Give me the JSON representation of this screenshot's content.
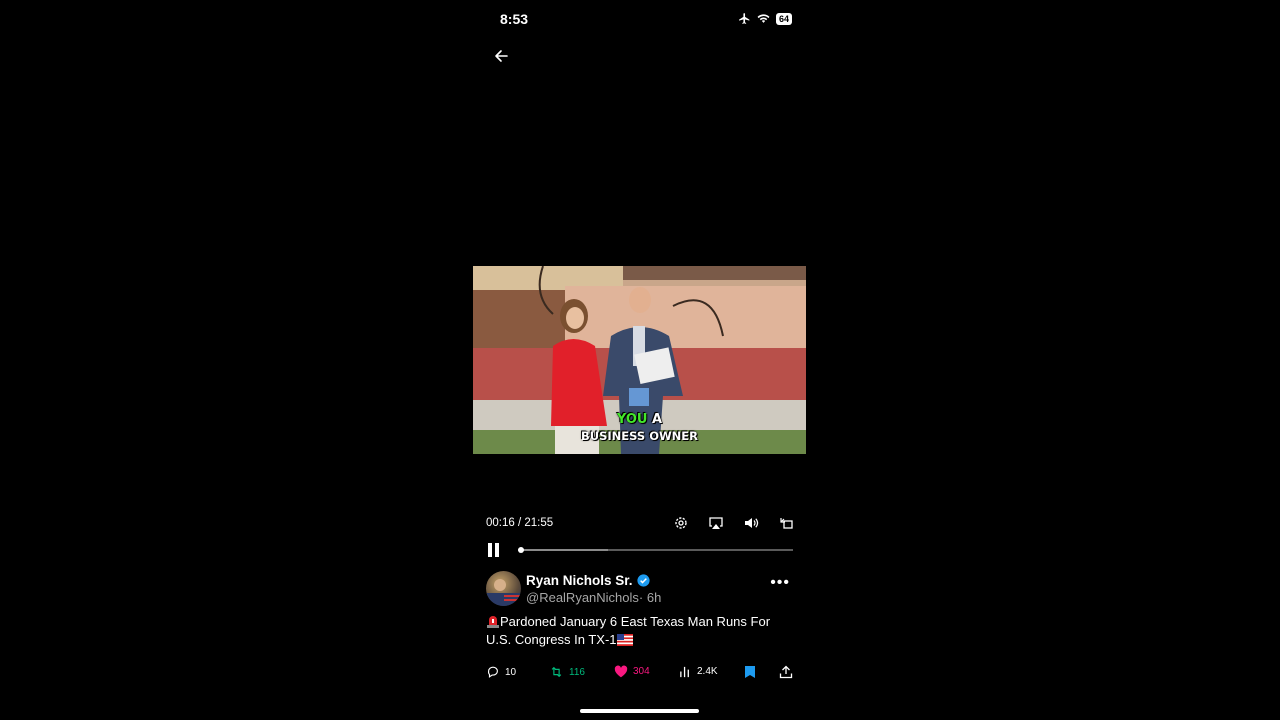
{
  "status_bar": {
    "time": "8:53",
    "battery": "64"
  },
  "video": {
    "caption_highlight": "YOU",
    "caption_rest": " A",
    "caption_line2": "BUSINESS OWNER"
  },
  "player": {
    "time_display": "00:16 / 21:55",
    "progress_fraction": 0.012
  },
  "post": {
    "author_name": "Ryan Nichols Sr.",
    "handle": "@RealRyanNichols",
    "age": "· 6h",
    "text": "Pardoned January 6 East Texas Man Runs For U.S. Congress In TX-1"
  },
  "actions": {
    "replies": "10",
    "reposts": "116",
    "likes": "304",
    "views": "2.4K"
  },
  "colors": {
    "repost": "#00ba7c",
    "like": "#f91880",
    "verified": "#1d9bf0",
    "bookmark": "#1d9bf0"
  }
}
